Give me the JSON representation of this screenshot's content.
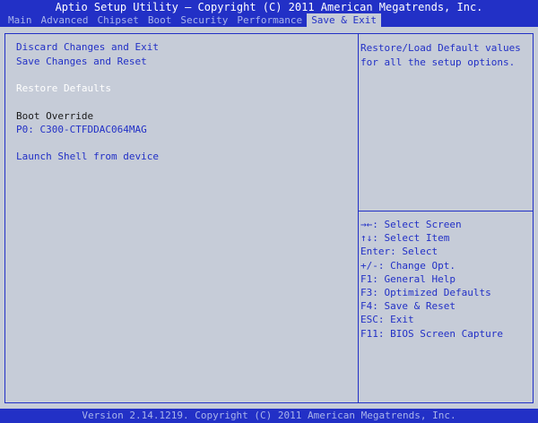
{
  "header": {
    "title": "Aptio Setup Utility – Copyright (C) 2011 American Megatrends, Inc."
  },
  "menu": {
    "items": [
      "Main",
      "Advanced",
      "Chipset",
      "Boot",
      "Security",
      "Performance",
      "Save & Exit"
    ],
    "active": "Save & Exit"
  },
  "left": {
    "discard_exit": "Discard Changes and Exit",
    "save_reset": "Save Changes and Reset",
    "restore_defaults": "Restore Defaults",
    "boot_override": "Boot Override",
    "boot_device": "P0: C300-CTFDDAC064MAG",
    "launch_shell": "Launch Shell from device"
  },
  "help": {
    "text": "Restore/Load Default values for all the setup options."
  },
  "keys": [
    "→←: Select Screen",
    "↑↓: Select Item",
    "Enter: Select",
    "+/-: Change Opt.",
    "F1: General Help",
    "F3: Optimized Defaults",
    "F4: Save & Reset",
    "ESC: Exit",
    "F11: BIOS Screen Capture"
  ],
  "footer": {
    "text": "Version 2.14.1219. Copyright (C) 2011 American Megatrends, Inc."
  },
  "colors": {
    "bios_blue": "#2230c6",
    "panel_gray": "#c6ccd8",
    "menu_inactive": "#a9b4ea",
    "highlight_white": "#ffffff"
  }
}
